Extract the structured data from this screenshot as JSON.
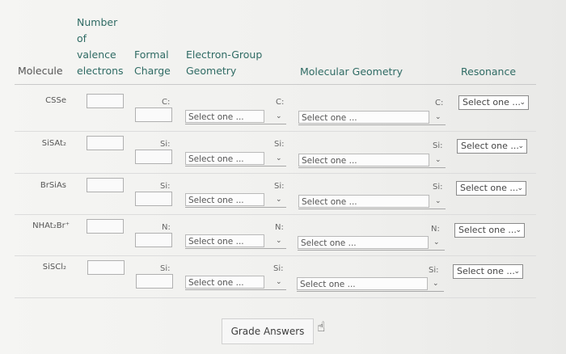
{
  "headers": {
    "molecule": "Molecule",
    "valence_1": "Number",
    "valence_2": "of",
    "valence_3": "valence",
    "valence_4": "electrons",
    "formal_1": "Formal",
    "formal_2": "Charge",
    "egeo_1": "Electron-Group",
    "egeo_2": "Geometry",
    "mgeo": "Molecular Geometry",
    "resonance": "Resonance"
  },
  "select_placeholder": "Select one ...",
  "rows": [
    {
      "molecule": "CSSe",
      "atom": "C:"
    },
    {
      "molecule": "SiSAt₂",
      "atom": "Si:"
    },
    {
      "molecule": "BrSiAs",
      "atom": "Si:"
    },
    {
      "molecule": "NHAt₂Br⁺",
      "atom": "N:"
    },
    {
      "molecule": "SiSCl₂",
      "atom": "Si:"
    }
  ],
  "grade_button": "Grade Answers",
  "icons": {
    "chevron": "chevron-down-icon",
    "cursor": "hand-pointer-icon"
  },
  "colors": {
    "header_teal": "#2f6b64",
    "background": "#f3f3f1"
  }
}
